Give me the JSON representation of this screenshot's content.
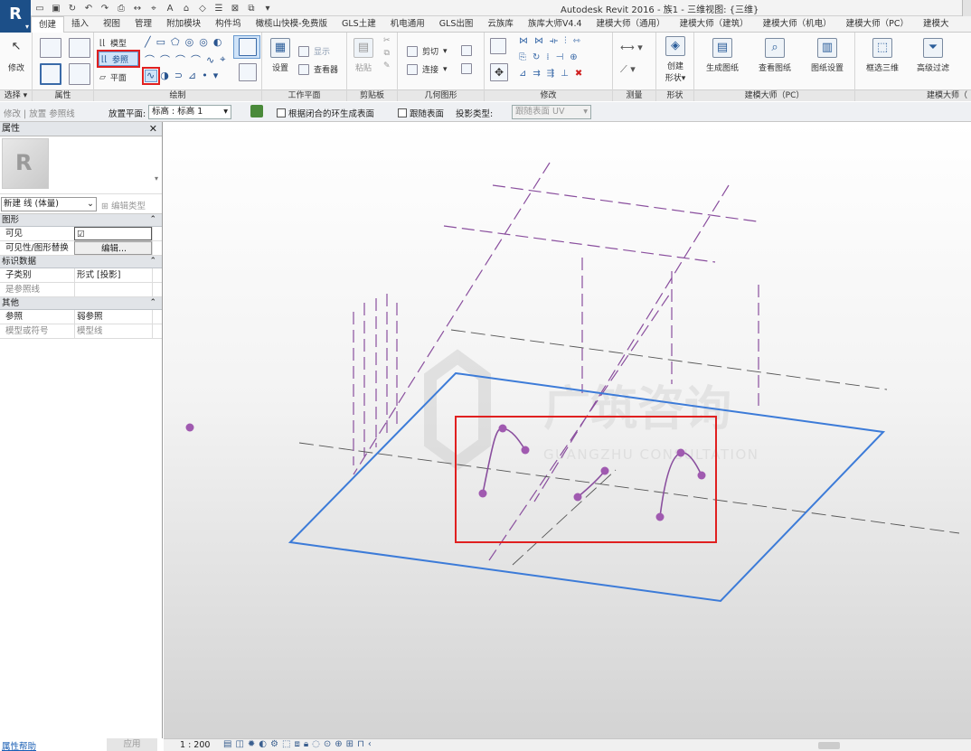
{
  "app": {
    "logo": "R",
    "title": "Autodesk Revit 2016 -    族1 - 三维视图: {三维}"
  },
  "qat_icons": [
    "open-icon",
    "save-icon",
    "sync-icon",
    "undo-icon",
    "redo-icon",
    "print-icon",
    "measure-icon",
    "tag-icon",
    "text-icon",
    "3d-view-icon",
    "section-icon",
    "thin-lines-icon",
    "close-windows-icon",
    "switch-windows-icon",
    "dropdown-icon"
  ],
  "tabs": [
    "创建",
    "插入",
    "视图",
    "管理",
    "附加模块",
    "构件坞",
    "橄榄山快模-免费版",
    "GLS土建",
    "机电通用",
    "GLS出图",
    "云族库",
    "族库大师V4.4",
    "建模大师（通用）",
    "建模大师（建筑）",
    "建模大师（机电）",
    "建模大师（PC）",
    "建模大"
  ],
  "active_tab": 0,
  "ribbon": {
    "select": {
      "modify": "修改",
      "label": "选择 ▾"
    },
    "properties": {
      "label": "属性"
    },
    "draw": {
      "model": "模型",
      "reference": "参照",
      "plane": "平面",
      "label": "绘制"
    },
    "workplane": {
      "set": "设置",
      "show": "显示",
      "viewer": "查看器",
      "label": "工作平面"
    },
    "clipboard": {
      "paste": "粘贴",
      "label": "剪贴板"
    },
    "geometry": {
      "cut": "剪切",
      "join": "连接",
      "label": "几何图形"
    },
    "modify": {
      "label": "修改"
    },
    "measure": {
      "label": "测量"
    },
    "form": {
      "create": "创建",
      "create2": "形状",
      "label": "形状"
    },
    "pc": {
      "gen_drawing": "生成图纸",
      "view_drawing": "查看图纸",
      "drawing_settings": "图纸设置",
      "label": "建模大师（PC）"
    },
    "pc2": {
      "box_select": "框选三维",
      "adv_filter": "高级过滤",
      "label": "建模大师（"
    }
  },
  "options": {
    "modify_label": "修改 | 放置 参照线",
    "place_plane_label": "放置平面:",
    "place_plane_value": "标高 : 标高 1",
    "surface_from_loop": "根据闭合的环生成表面",
    "follow_surface": "跟随表面",
    "projection_type_label": "投影类型:",
    "projection_type_value": "跟随表面 UV"
  },
  "properties": {
    "title": "属性",
    "type_name": "新建 线 (体量)",
    "edit_type": "编辑类型",
    "groups": [
      {
        "name": "图形",
        "rows": [
          {
            "k": "可见",
            "v": "☑",
            "dim": false
          },
          {
            "k": "可见性/图形替换",
            "v": "编辑...",
            "dim": false
          }
        ]
      },
      {
        "name": "标识数据",
        "rows": [
          {
            "k": "子类别",
            "v": "形式 [投影]",
            "dim": false
          },
          {
            "k": "是参照线",
            "v": "",
            "dim": true
          }
        ]
      },
      {
        "name": "其他",
        "rows": [
          {
            "k": "参照",
            "v": "弱参照",
            "dim": false
          },
          {
            "k": "模型或符号",
            "v": "模型线",
            "dim": true
          }
        ]
      }
    ],
    "help": "属性帮助",
    "apply": "应用"
  },
  "watermark": {
    "cn": "广筑咨询",
    "en": "GUANGZHU CONSULTATION"
  },
  "status": {
    "scale": "1 : 200"
  },
  "colors": {
    "ref_line": "#8a4f9e",
    "work_plane": "#3c7bd8",
    "highlight": "#e02020"
  }
}
